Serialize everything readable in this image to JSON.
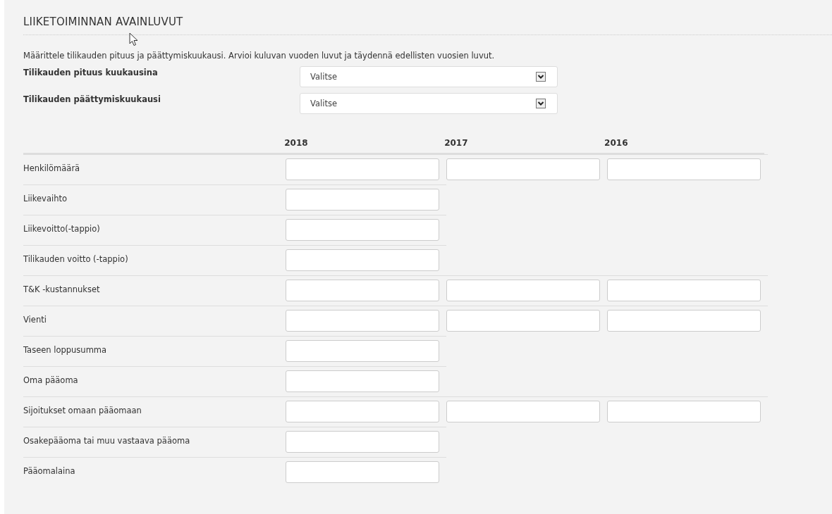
{
  "section": {
    "title": "LIIKETOIMINNAN AVAINLUVUT",
    "description": "Määrittele tilikauden pituus ja päättymiskuukausi. Arvioi kuluvan vuoden luvut ja täydennä edellisten vuosien luvut."
  },
  "selects": [
    {
      "label": "Tilikauden pituus kuukausina",
      "value": "Valitse"
    },
    {
      "label": "Tilikauden päättymiskuukausi",
      "value": "Valitse"
    }
  ],
  "table": {
    "columns": [
      "2018",
      "2017",
      "2016"
    ],
    "rows": [
      {
        "label": "Henkilömäärä",
        "kind": "all_years"
      },
      {
        "label": "Liikevaihto",
        "kind": "current_year"
      },
      {
        "label": "Liikevoitto(-tappio)",
        "kind": "current_year"
      },
      {
        "label": "Tilikauden voitto (-tappio)",
        "kind": "current_year"
      },
      {
        "label": "T&K -kustannukset",
        "kind": "all_years"
      },
      {
        "label": "Vienti",
        "kind": "all_years"
      },
      {
        "label": "Taseen loppusumma",
        "kind": "current_year"
      },
      {
        "label": "Oma pääoma",
        "kind": "current_year"
      },
      {
        "label": "Sijoitukset omaan pääomaan",
        "kind": "all_years"
      },
      {
        "label": "Osakepääoma tai muu vastaava pääoma",
        "kind": "current_year"
      },
      {
        "label": "Pääomalaina",
        "kind": "current_year"
      }
    ]
  }
}
